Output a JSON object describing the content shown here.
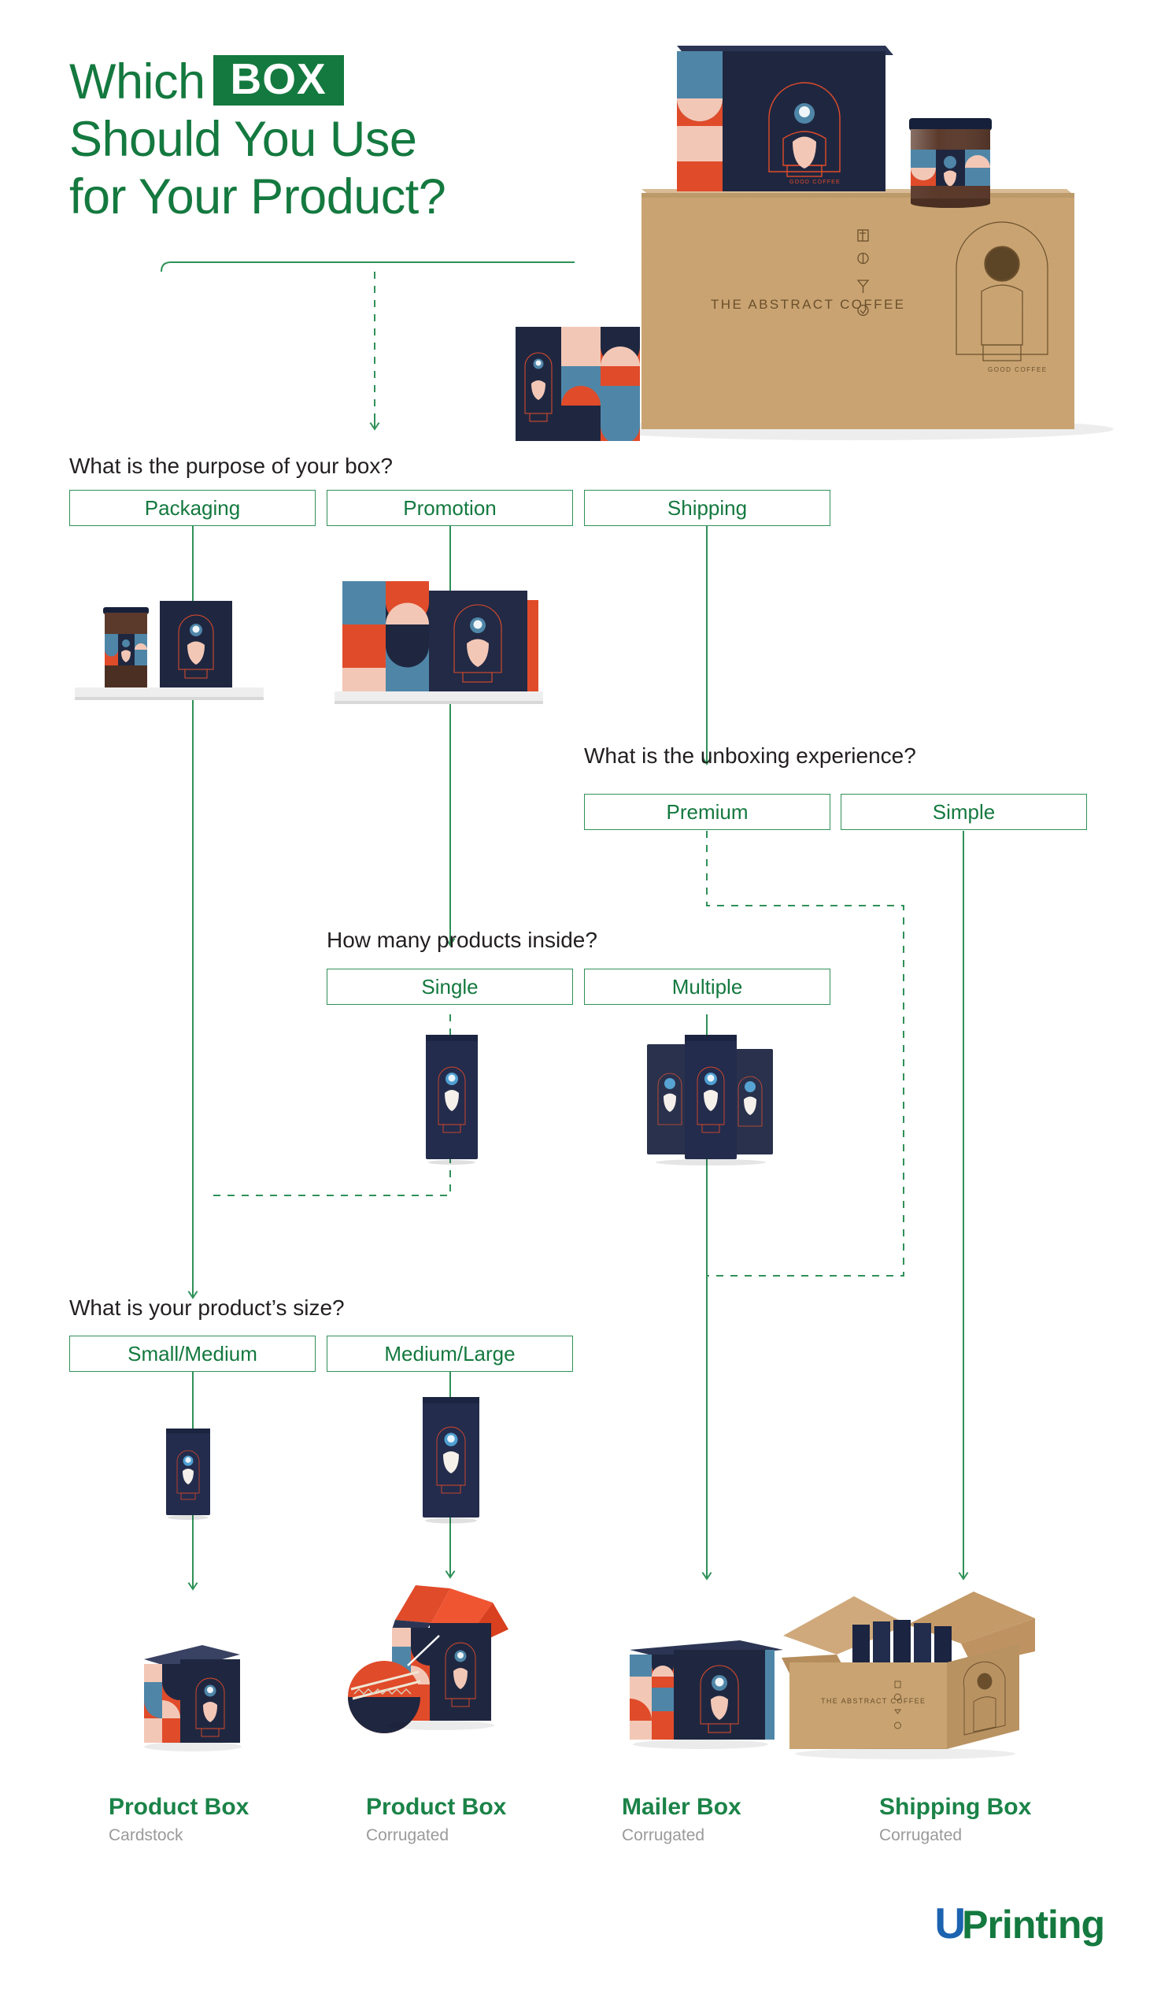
{
  "title": {
    "line1_a": "Which",
    "chip": "BOX",
    "line2": "Should You Use",
    "line3": "for Your Product?"
  },
  "brand": {
    "name_u": "U",
    "name_rest": "Printing",
    "color_blue": "#1c63b0",
    "color_green": "#14793f"
  },
  "colors": {
    "green": "#14793f",
    "green_line": "#2f9158",
    "text": "#231f20",
    "sub_text": "#9a9a9a",
    "kraft": "#c49a68",
    "navy": "#1f2740",
    "red": "#e04b2a",
    "blush": "#f3c7b6",
    "blue": "#4f86a8"
  },
  "product_brand_text": "THE ABSTRACT COFFEE",
  "questions": [
    {
      "id": "q-purpose",
      "text": "What is the purpose of your box?",
      "options": [
        "Packaging",
        "Promotion",
        "Shipping"
      ]
    },
    {
      "id": "q-unboxing",
      "text": "What is the unboxing experience?",
      "options": [
        "Premium",
        "Simple"
      ]
    },
    {
      "id": "q-quantity",
      "text": "How many products inside?",
      "options": [
        "Single",
        "Multiple"
      ]
    },
    {
      "id": "q-size",
      "text": "What is your product’s size?",
      "options": [
        "Small/Medium",
        "Medium/Large"
      ]
    }
  ],
  "results": [
    {
      "title": "Product Box",
      "material": "Cardstock"
    },
    {
      "title": "Product Box",
      "material": "Corrugated"
    },
    {
      "title": "Mailer Box",
      "material": "Corrugated"
    },
    {
      "title": "Shipping Box",
      "material": "Corrugated"
    }
  ]
}
